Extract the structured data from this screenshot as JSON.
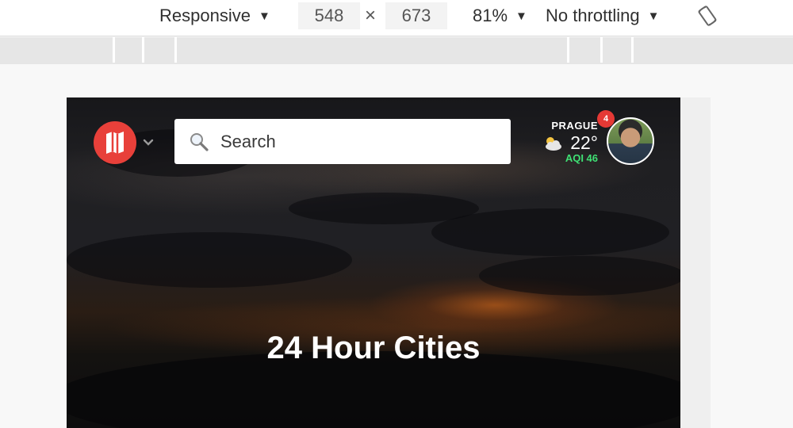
{
  "devtools": {
    "device_mode": "Responsive",
    "width": "548",
    "height": "673",
    "times": "×",
    "zoom": "81%",
    "throttling": "No throttling",
    "caret": "▼",
    "rotate_icon": "rotate-icon"
  },
  "site": {
    "logo_icon": "map-logo-icon",
    "menu_icon": "chevron-down-icon",
    "search": {
      "placeholder": "Search",
      "value": ""
    },
    "weather": {
      "city": "PRAGUE",
      "temperature": "22°",
      "aqi": "AQI 46",
      "icon": "partly-cloudy-icon"
    },
    "notifications": {
      "count": "4"
    },
    "hero": {
      "title": "24 Hour Cities"
    },
    "colors": {
      "brand": "#e8403a",
      "badge": "#e53935",
      "aqi": "#3fe074"
    }
  }
}
